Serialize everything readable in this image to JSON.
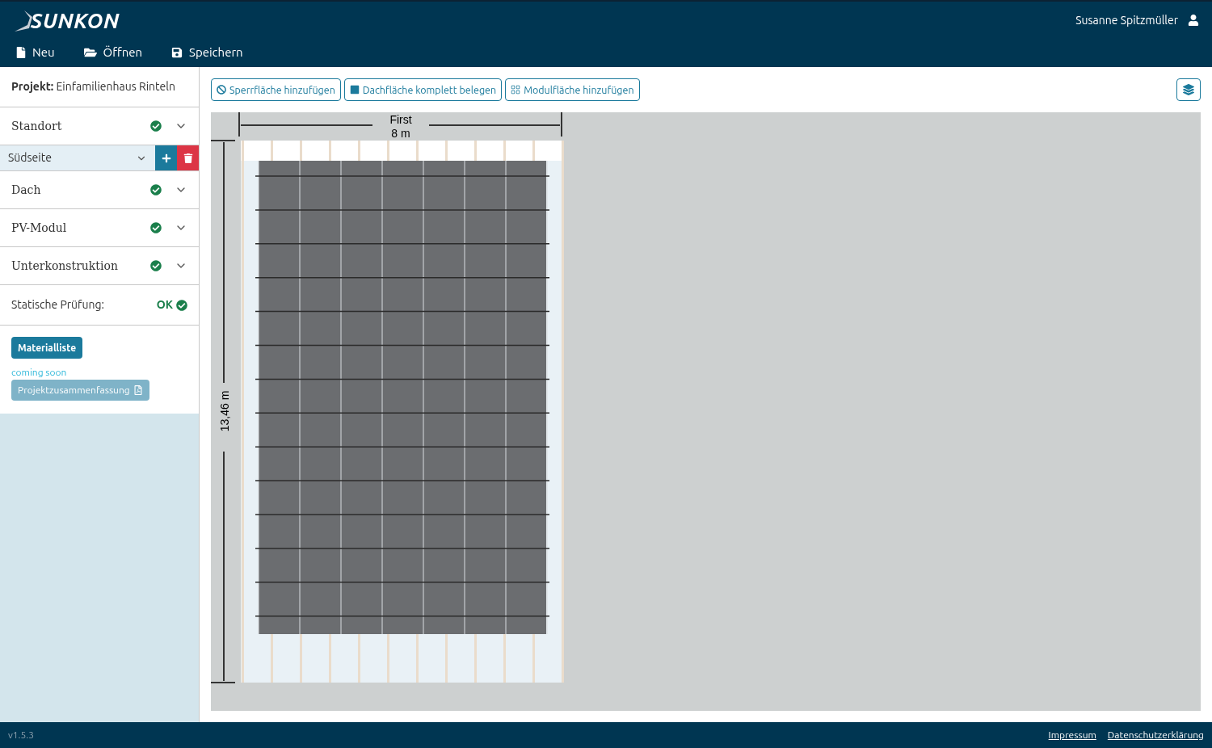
{
  "header": {
    "logo": "SUNKON",
    "user": "Susanne Spitzmüller",
    "menu": [
      {
        "kind": "new",
        "label": "Neu"
      },
      {
        "kind": "open",
        "label": "Öffnen"
      },
      {
        "kind": "save",
        "label": "Speichern"
      }
    ]
  },
  "sidebar": {
    "project_label": "Projekt:",
    "project_name": "Einfamilienhaus Rinteln",
    "sections": [
      {
        "kind": "section",
        "label": "Standort",
        "complete": true
      },
      {
        "kind": "selector",
        "label": "Südseite"
      },
      {
        "kind": "section",
        "label": "Dach",
        "complete": true
      },
      {
        "kind": "section",
        "label": "PV-Modul",
        "complete": true
      },
      {
        "kind": "section",
        "label": "Unterkonstruktion",
        "complete": true
      }
    ],
    "static_check": {
      "label": "Statische Prüfung:",
      "status": "OK",
      "passed": true
    },
    "material_button": "Materialliste",
    "coming_soon": "coming soon",
    "summary_button": {
      "label": "Projektzusammenfassung",
      "disabled": true
    }
  },
  "toolbar": [
    {
      "kind": "block",
      "label": "Sperrfläche hinzufügen"
    },
    {
      "kind": "fill",
      "label": "Dachfläche komplett belegen"
    },
    {
      "kind": "grid",
      "label": "Modulfläche hinzufügen"
    }
  ],
  "canvas": {
    "ridge_label": "First",
    "width_label": "8 m",
    "height_label": "13,46 m"
  },
  "footer": {
    "version": "v1.5.3",
    "links": [
      "Impressum",
      "Datenschutzerklärung"
    ]
  }
}
